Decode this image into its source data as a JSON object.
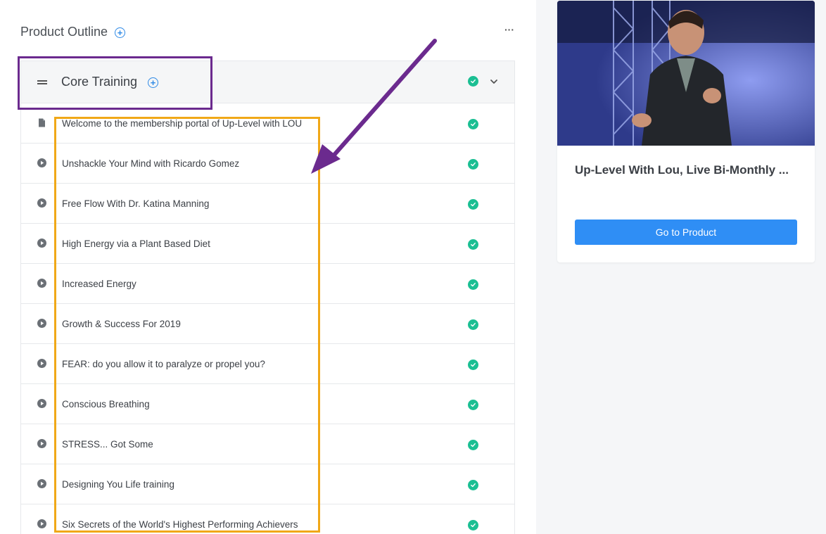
{
  "outline": {
    "title": "Product Outline",
    "add_icon": "plus-circle-icon",
    "more_icon": "ellipsis-icon",
    "more_label": "···"
  },
  "section": {
    "title": "Core Training",
    "drag_icon": "drag-handle-icon",
    "add_icon": "plus-circle-icon",
    "status_icon": "check-circle-icon",
    "toggle_icon": "chevron-down-icon",
    "lessons": [
      {
        "title": "Welcome to the membership portal of Up-Level with LOU",
        "type_icon": "document-icon",
        "status_icon": "check-circle-icon"
      },
      {
        "title": "Unshackle Your Mind with Ricardo Gomez",
        "type_icon": "play-circle-icon",
        "status_icon": "check-circle-icon"
      },
      {
        "title": "Free Flow With Dr. Katina Manning",
        "type_icon": "play-circle-icon",
        "status_icon": "check-circle-icon"
      },
      {
        "title": "High Energy via a Plant Based Diet",
        "type_icon": "play-circle-icon",
        "status_icon": "check-circle-icon"
      },
      {
        "title": "Increased Energy",
        "type_icon": "play-circle-icon",
        "status_icon": "check-circle-icon"
      },
      {
        "title": "Growth & Success For 2019",
        "type_icon": "play-circle-icon",
        "status_icon": "check-circle-icon"
      },
      {
        "title": "FEAR: do you allow it to paralyze or propel you?",
        "type_icon": "play-circle-icon",
        "status_icon": "check-circle-icon"
      },
      {
        "title": "Conscious Breathing",
        "type_icon": "play-circle-icon",
        "status_icon": "check-circle-icon"
      },
      {
        "title": "STRESS... Got Some",
        "type_icon": "play-circle-icon",
        "status_icon": "check-circle-icon"
      },
      {
        "title": "Designing You Life training",
        "type_icon": "play-circle-icon",
        "status_icon": "check-circle-icon"
      },
      {
        "title": "Six Secrets of the World's Highest Performing Achievers",
        "type_icon": "play-circle-icon",
        "status_icon": "check-circle-icon"
      }
    ]
  },
  "product_card": {
    "image": "speaker-photo",
    "title": "Up-Level With Lou, Live Bi-Monthly ...",
    "button_label": "Go to Product"
  },
  "colors": {
    "accent_blue": "#2f8ef5",
    "check_green": "#1bbf93",
    "annotation_purple": "#6b2a8e",
    "annotation_orange": "#f0a818"
  }
}
